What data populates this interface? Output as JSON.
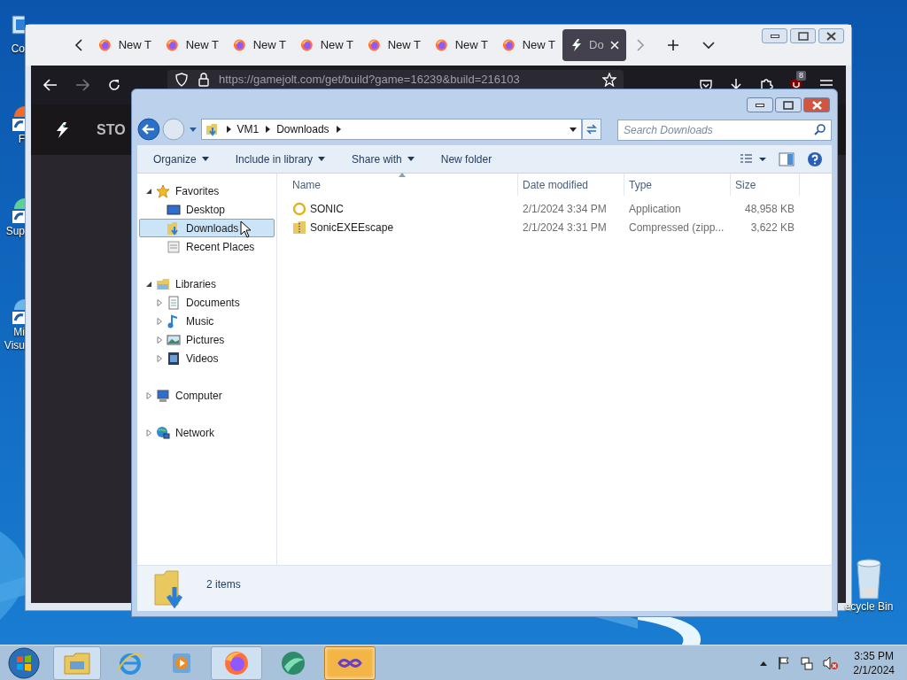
{
  "desktop_icons": [
    {
      "label": "Co",
      "kind": "computer"
    },
    {
      "label": "F",
      "kind": "app"
    },
    {
      "label": "Sup",
      "kind": "app"
    },
    {
      "label": "Mi",
      "label_2": "Visu",
      "kind": "app"
    }
  ],
  "recycle_bin": {
    "label": "ecycle Bin"
  },
  "browser": {
    "tabs": [
      {
        "label": "New T",
        "kind": "firefox",
        "selected": false
      },
      {
        "label": "New T",
        "kind": "firefox",
        "selected": false
      },
      {
        "label": "New T",
        "kind": "firefox",
        "selected": false
      },
      {
        "label": "New T",
        "kind": "firefox",
        "selected": false
      },
      {
        "label": "New T",
        "kind": "firefox",
        "selected": false
      },
      {
        "label": "New T",
        "kind": "firefox",
        "selected": false
      },
      {
        "label": "New T",
        "kind": "firefox",
        "selected": false
      },
      {
        "label": "Do",
        "kind": "gamejolt",
        "selected": true
      }
    ],
    "url": "https://gamejolt.com/get/build?game=16239&build=216103",
    "extension_badge": "8",
    "site_nav": "STO"
  },
  "explorer": {
    "breadcrumb": [
      "VM1",
      "Downloads"
    ],
    "search": {
      "placeholder": "Search Downloads"
    },
    "toolbar": [
      {
        "label": "Organize",
        "dropdown": true
      },
      {
        "label": "Include in library",
        "dropdown": true
      },
      {
        "label": "Share with",
        "dropdown": true
      },
      {
        "label": "New folder",
        "dropdown": false
      }
    ],
    "nav": [
      {
        "label": "Favorites",
        "kind": "star",
        "expanded": true,
        "selected": false,
        "children": [
          {
            "label": "Desktop",
            "kind": "desktop",
            "selected": false
          },
          {
            "label": "Downloads",
            "kind": "downloads",
            "selected": true
          },
          {
            "label": "Recent Places",
            "kind": "recent",
            "selected": false
          }
        ]
      },
      {
        "label": "Libraries",
        "kind": "library",
        "expanded": true,
        "selected": false,
        "children": [
          {
            "label": "Documents",
            "kind": "documents",
            "expanded": false,
            "selected": false
          },
          {
            "label": "Music",
            "kind": "music",
            "expanded": false,
            "selected": false
          },
          {
            "label": "Pictures",
            "kind": "pictures",
            "expanded": false,
            "selected": false
          },
          {
            "label": "Videos",
            "kind": "videos",
            "expanded": false,
            "selected": false
          }
        ]
      },
      {
        "label": "Computer",
        "kind": "computer",
        "expanded": false,
        "selected": false
      },
      {
        "label": "Network",
        "kind": "network",
        "expanded": false,
        "selected": false
      }
    ],
    "columns": [
      "Name",
      "Date modified",
      "Type",
      "Size"
    ],
    "rows": [
      {
        "name": "SONIC",
        "kind": "application",
        "date": "2/1/2024 3:34 PM",
        "type": "Application",
        "size": "48,958 KB"
      },
      {
        "name": "SonicEXEEscape",
        "kind": "zip",
        "date": "2/1/2024 3:31 PM",
        "type": "Compressed (zipp...",
        "size": "3,622 KB"
      }
    ],
    "status": "2 items"
  },
  "taskbar": {
    "apps": [
      {
        "kind": "explorer",
        "running": true,
        "active": false
      },
      {
        "kind": "ie",
        "running": false,
        "active": false
      },
      {
        "kind": "media",
        "running": false,
        "active": false
      },
      {
        "kind": "firefox",
        "running": true,
        "active": false
      },
      {
        "kind": "green",
        "running": false,
        "active": false
      },
      {
        "kind": "vs",
        "running": true,
        "active": true
      }
    ],
    "time": "3:35 PM",
    "date": "2/1/2024"
  }
}
